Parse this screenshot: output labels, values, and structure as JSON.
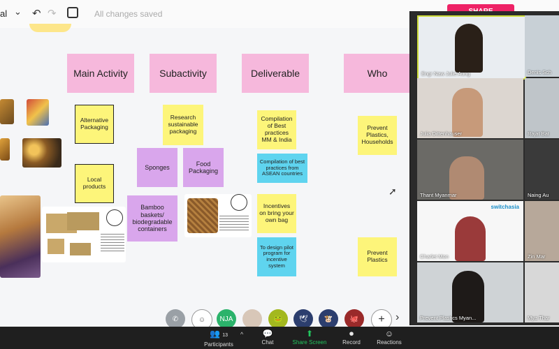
{
  "toolbar": {
    "doc_name": "al",
    "saved_status": "All changes saved",
    "share_label": "SHARE"
  },
  "headers": [
    "Main Activity",
    "Subactivity",
    "Deliverable",
    "Who"
  ],
  "notes": {
    "alt_packaging": "Alternative Packaging",
    "local_products": "Local products",
    "research": "Research sustainable packaging",
    "sponges": "Sponges",
    "food_packaging": "Food Packaging",
    "bamboo": "Bamboo baskets/ biodegradable containers",
    "compilation_mm": "Compilation of Best practices MM & India",
    "compilation_asean": "Compilation of best practices from ASEAN countries",
    "incentives": "Incentives on bring your own bag",
    "design_pilot": "To design pilot program for incentive system",
    "prevent_households": "Prevent Plastics, Households",
    "prevent_plastics": "Prevent Plastics"
  },
  "participants": [
    "Engr Naw Julie Aung",
    "Denis Sch",
    "Julia Dittenhauser",
    "Rajat Bat",
    "Thant Myanmar",
    "Naing Au",
    "Charlet Mon",
    "Zin Mar",
    "Prevent Plastics Myan...",
    "Mya Thar"
  ],
  "switchasia_label": "switchasia",
  "avatar_initials": "NJA",
  "zoom": {
    "participants_label": "Participants",
    "participants_count": "13",
    "chat_label": "Chat",
    "share_label": "Share Screen",
    "record_label": "Record",
    "reactions_label": "Reactions"
  },
  "colors": {
    "pink": "#f6b8dc",
    "yellow": "#fdf57a",
    "purple": "#d9a6ec",
    "cyan": "#5fd4ef",
    "share_accent": "#22c55e",
    "share_button": "#ee2266"
  }
}
